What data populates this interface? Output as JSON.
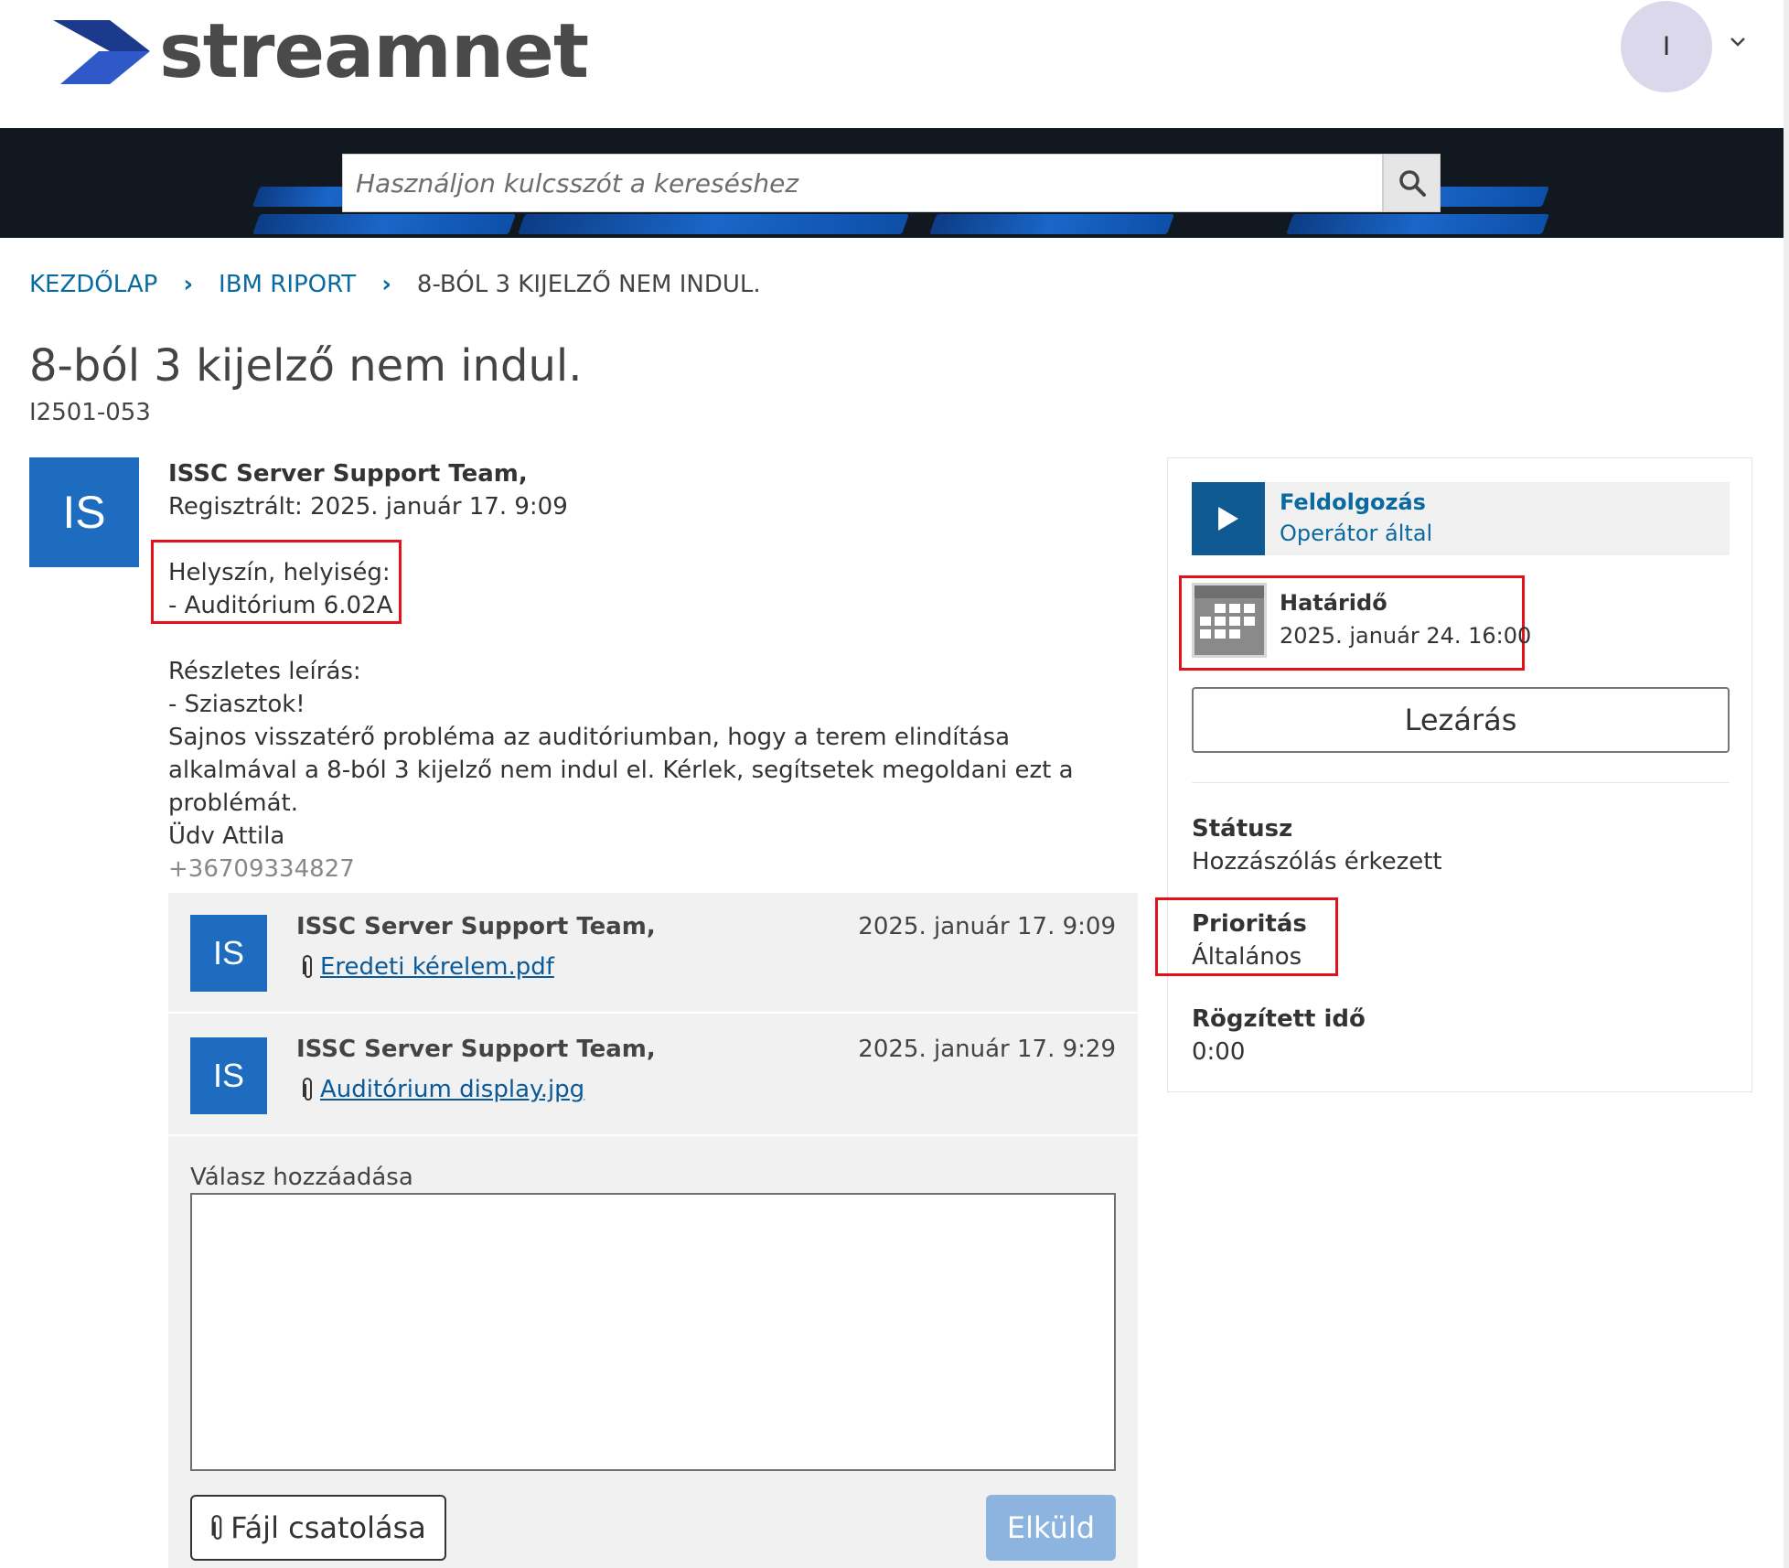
{
  "header": {
    "logo_text": "streamnet",
    "user_initial": "I"
  },
  "search": {
    "placeholder": "Használjon kulcsszót a kereséshez"
  },
  "breadcrumb": {
    "home": "KEZDŐLAP",
    "section": "IBM RIPORT",
    "current": "8-BÓL 3 KIJELZŐ NEM INDUL."
  },
  "ticket": {
    "title": "8-ból 3 kijelző nem indul.",
    "id": "I2501-053"
  },
  "post": {
    "avatar": "IS",
    "author": "ISSC Server Support Team,",
    "registered": "Regisztrált: 2025. január 17. 9:09",
    "location_label": "Helyszín, helyiség:",
    "location_value": "- Auditórium 6.02A",
    "desc_label": "Részletes leírás:",
    "desc_greeting": "- Sziasztok!",
    "desc_body": "Sajnos visszatérő probléma az auditóriumban, hogy a terem elindítása alkalmával a 8-ból 3 kijelző nem indul el. Kérlek, segítsetek megoldani ezt a problémát.",
    "desc_sign": "Üdv Attila",
    "phone": "+36709334827"
  },
  "thread": {
    "messages": [
      {
        "avatar": "IS",
        "author": "ISSC Server Support Team,",
        "date": "2025. január 17. 9:09",
        "file": "Eredeti kérelem.pdf"
      },
      {
        "avatar": "IS",
        "author": "ISSC Server Support Team,",
        "date": "2025. január 17. 9:29",
        "file": "Auditórium display.jpg"
      }
    ],
    "reply_label": "Válasz hozzáadása",
    "attach_label": "Fájl csatolása",
    "send_label": "Elküld"
  },
  "sidebar": {
    "process_title": "Feldolgozás",
    "process_sub": "Operátor által",
    "deadline_label": "Határidő",
    "deadline_value": "2025. január 24. 16:00",
    "close_label": "Lezárás",
    "status_label": "Státusz",
    "status_value": "Hozzászólás érkezett",
    "priority_label": "Prioritás",
    "priority_value": "Általános",
    "time_label": "Rögzített idő",
    "time_value": "0:00"
  },
  "colors": {
    "accent_blue": "#1e6cc0",
    "link_blue": "#0a6aa0",
    "highlight_red": "#e3111a",
    "send_disabled": "#8cb4df"
  }
}
